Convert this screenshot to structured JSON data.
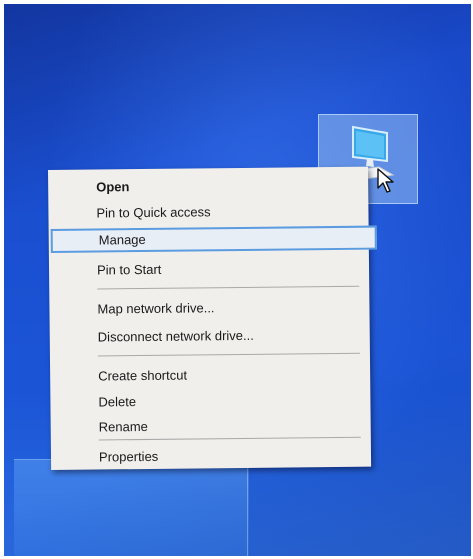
{
  "desktop": {
    "icon_name": "computer-icon",
    "selected": true
  },
  "context_menu": {
    "items": [
      {
        "label": "Open",
        "bold": true
      },
      {
        "label": "Pin to Quick access"
      },
      {
        "label": "Manage",
        "highlighted": true
      },
      {
        "label": "Pin to Start"
      },
      {
        "label": "Map network drive..."
      },
      {
        "label": "Disconnect network drive..."
      },
      {
        "label": "Create shortcut"
      },
      {
        "label": "Delete"
      },
      {
        "label": "Rename"
      },
      {
        "label": "Properties"
      }
    ]
  },
  "colors": {
    "desktop_background": "#1b4fd0",
    "menu_background": "#f0efec",
    "highlight_border": "#5b9be0"
  }
}
